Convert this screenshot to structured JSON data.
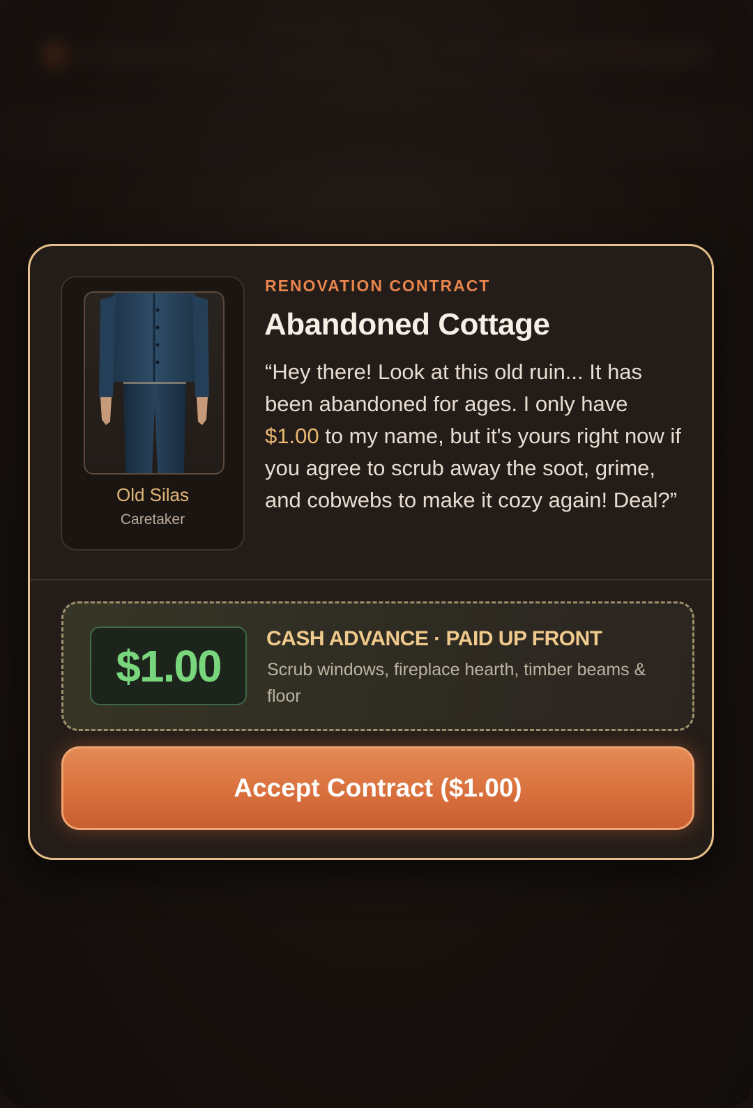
{
  "contract": {
    "kicker": "RENOVATION CONTRACT",
    "title": "Abandoned Cottage"
  },
  "npc": {
    "name": "Old Silas",
    "role": "Caretaker",
    "portrait_icon": "character-portrait"
  },
  "dialogue": {
    "part1": "“Hey there! Look at this old ruin... It has been abandoned for ages. I only have ",
    "amount": "$1.00",
    "part2": " to my name, but it's yours right now if you agree to scrub away the soot, grime, and cobwebs to make it cozy again! Deal?”"
  },
  "payment": {
    "amount": "$1.00",
    "title": "CASH ADVANCE · PAID UP FRONT",
    "description": "Scrub windows, fireplace hearth, timber beams & floor"
  },
  "actions": {
    "accept_label": "Accept Contract ($1.00)"
  },
  "colors": {
    "accent": "#e8854d",
    "border": "#e6c08a",
    "cash_green": "#79d67d",
    "button": "#d9703d"
  }
}
